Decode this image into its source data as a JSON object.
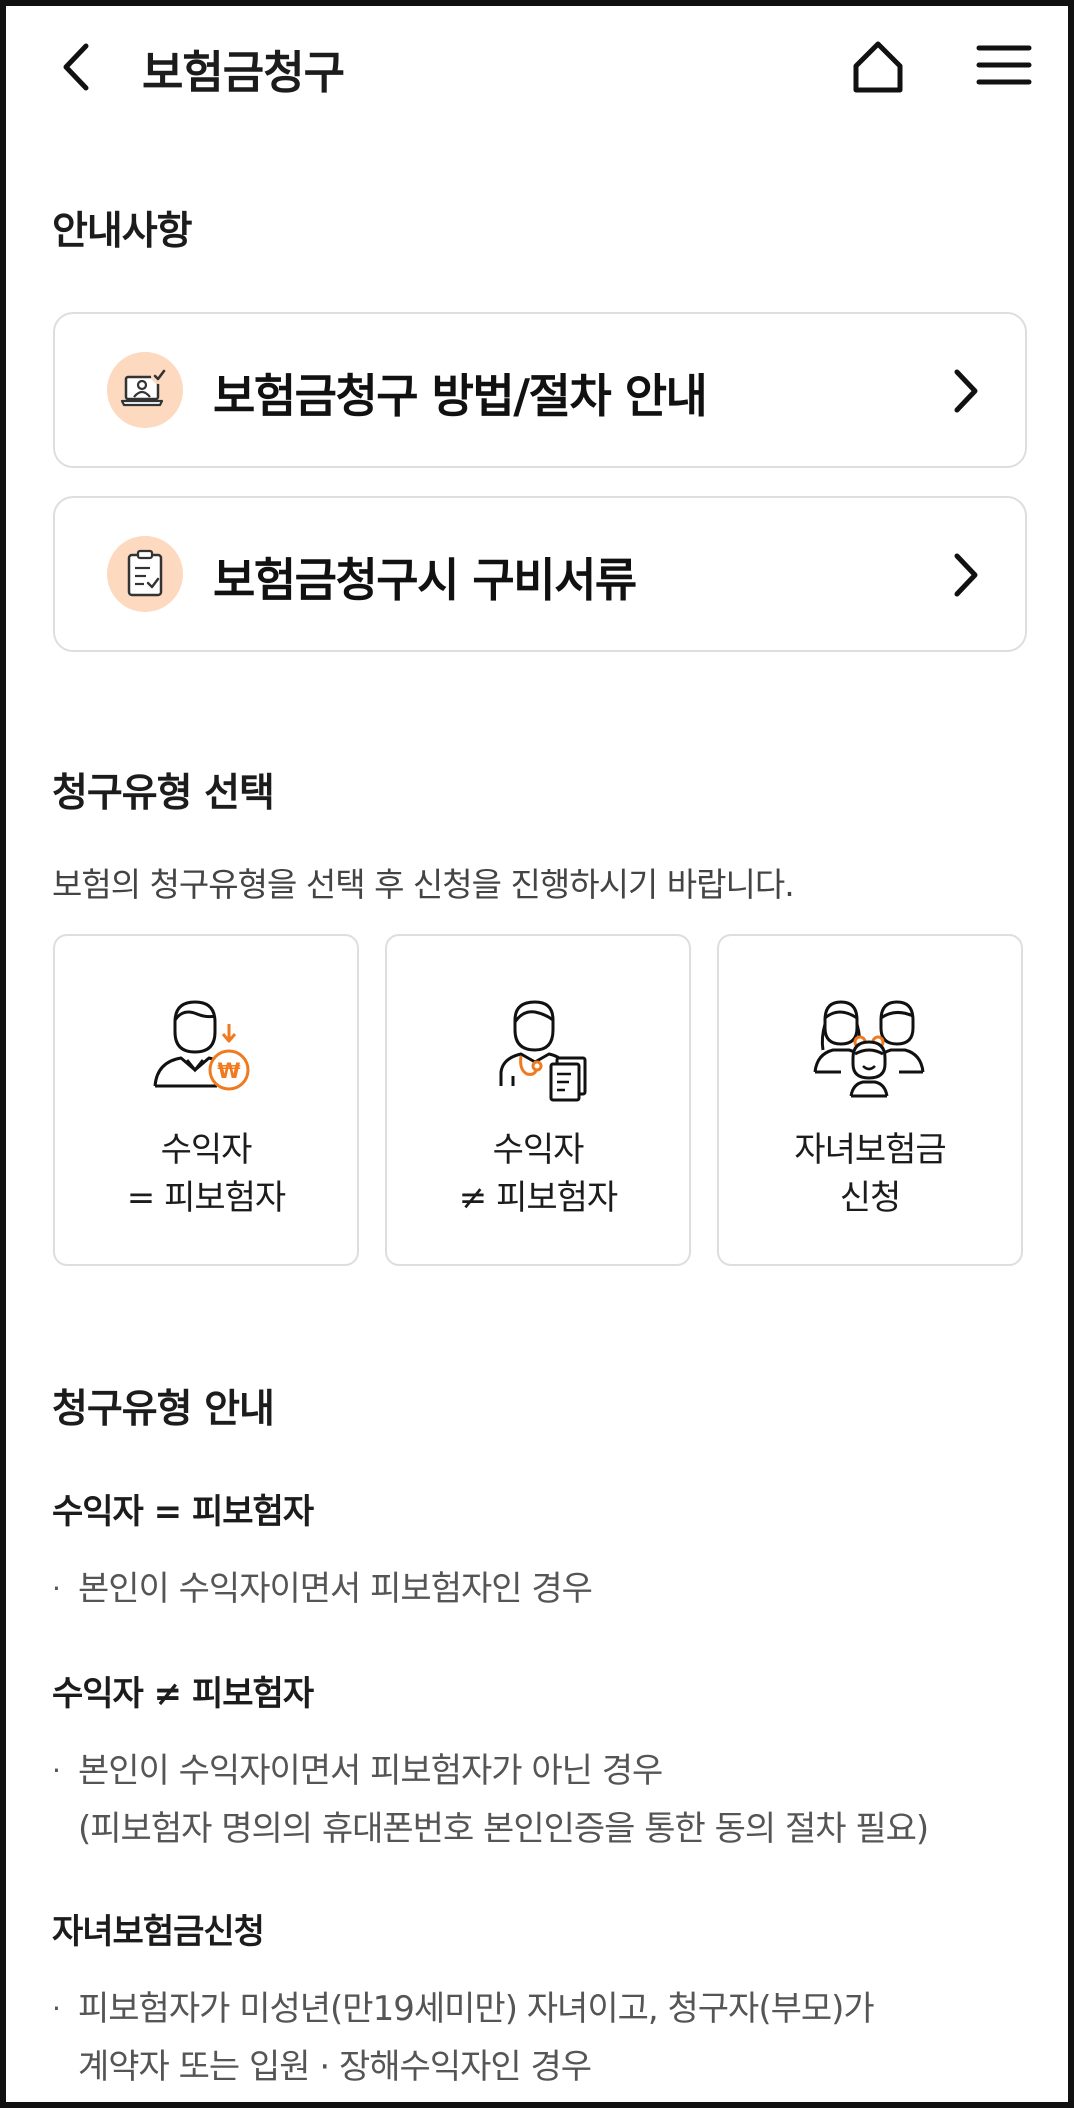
{
  "header": {
    "title": "보험금청구"
  },
  "notice": {
    "section_title": "안내사항",
    "cards": [
      {
        "label": "보험금청구 방법/절차 안내",
        "icon": "laptop-user-check-icon"
      },
      {
        "label": "보험금청구시 구비서류",
        "icon": "clipboard-check-icon"
      }
    ]
  },
  "claim_type": {
    "section_title": "청구유형 선택",
    "description": "보험의 청구유형을 선택 후 신청을 진행하시기 바랍니다.",
    "options": [
      {
        "line1": "수익자",
        "line2": "= 피보험자",
        "icon": "person-won-coin-icon"
      },
      {
        "line1": "수익자",
        "line2": "≠ 피보험자",
        "icon": "doctor-document-icon"
      },
      {
        "line1": "자녀보험금",
        "line2": "신청",
        "icon": "family-icon"
      }
    ]
  },
  "claim_guide": {
    "section_title": "청구유형 안내",
    "items": [
      {
        "title": "수익자 = 피보험자",
        "lines": [
          "본인이 수익자이면서 피보험자인 경우"
        ]
      },
      {
        "title": "수익자 ≠ 피보험자",
        "lines": [
          "본인이 수익자이면서 피보험자가 아닌 경우",
          "(피보험자 명의의 휴대폰번호 본인인증을 통한 동의 절차 필요)"
        ]
      },
      {
        "title": "자녀보험금신청",
        "lines": [
          "피보험자가 미성년(만19세미만) 자녀이고, 청구자(부모)가",
          "계약자 또는 입원 · 장해수익자인 경우"
        ]
      }
    ],
    "bullet_mark": "·"
  },
  "colors": {
    "accent": "#f07a1f",
    "icon_bg": "#fcd9bf",
    "border": "#dedede"
  }
}
